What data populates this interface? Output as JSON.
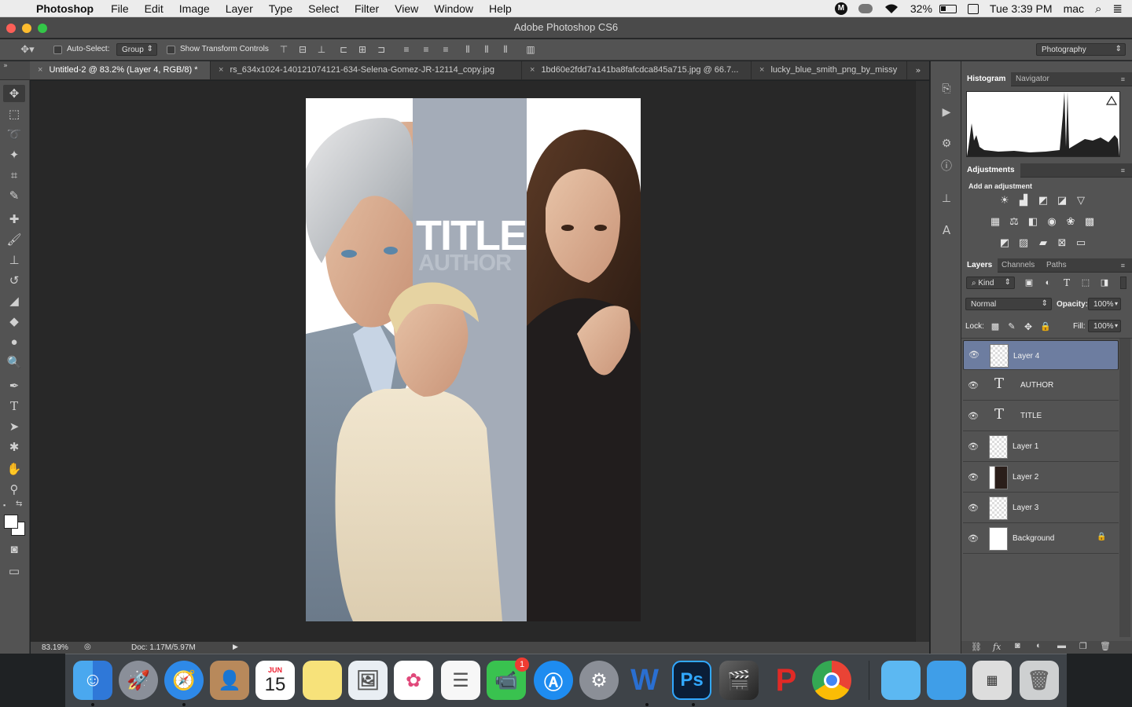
{
  "menubar": {
    "app": "Photoshop",
    "items": [
      "File",
      "Edit",
      "Image",
      "Layer",
      "Type",
      "Select",
      "Filter",
      "View",
      "Window",
      "Help"
    ],
    "battery": "32%",
    "clock": "Tue 3:39 PM",
    "user": "mac",
    "icons": [
      "apple-icon",
      "malwarebytes-icon",
      "creative-cloud-icon",
      "wifi-icon",
      "battery-icon",
      "calendar-icon",
      "search-icon",
      "list-icon"
    ]
  },
  "window": {
    "title": "Adobe Photoshop CS6"
  },
  "options": {
    "auto_select_label": "Auto-Select:",
    "auto_select_value": "Group",
    "transform_label": "Show Transform Controls",
    "workspace": "Photography"
  },
  "tabs": [
    {
      "label": "Untitled-2 @ 83.2% (Layer 4, RGB/8) *",
      "active": true
    },
    {
      "label": "rs_634x1024-140121074121-634-Selena-Gomez-JR-12114_copy.jpg",
      "active": false
    },
    {
      "label": "1bd60e2fdd7a141ba8fafcdca845a715.jpg @ 66.7...",
      "active": false
    },
    {
      "label": "lucky_blue_smith_png_by_missy",
      "active": false
    }
  ],
  "canvas": {
    "title_text": "TITLE",
    "author_text": "AUTHOR",
    "stripe_color": "#a4acb8"
  },
  "status": {
    "zoom": "83.19%",
    "doc": "Doc: 1.17M/5.97M"
  },
  "panels": {
    "histogram_tab": "Histogram",
    "navigator_tab": "Navigator",
    "adjustments_tab": "Adjustments",
    "add_adjustment": "Add an adjustment",
    "layers_tab": "Layers",
    "channels_tab": "Channels",
    "paths_tab": "Paths",
    "kind": "Kind",
    "blend_mode": "Normal",
    "opacity_label": "Opacity:",
    "opacity": "100%",
    "lock_label": "Lock:",
    "fill_label": "Fill:",
    "fill": "100%"
  },
  "layers": [
    {
      "name": "Layer 4",
      "type": "image",
      "selected": true
    },
    {
      "name": "AUTHOR",
      "type": "text",
      "selected": false
    },
    {
      "name": "TITLE",
      "type": "text",
      "selected": false
    },
    {
      "name": "Layer 1",
      "type": "image",
      "selected": false
    },
    {
      "name": "Layer 2",
      "type": "image",
      "selected": false
    },
    {
      "name": "Layer 3",
      "type": "image",
      "selected": false
    },
    {
      "name": "Background",
      "type": "background",
      "selected": false
    }
  ],
  "dock": {
    "calendar_month": "JUN",
    "calendar_day": "15",
    "facetime_badge": "1",
    "apps": [
      "Finder",
      "Launchpad",
      "Safari",
      "Contacts",
      "Calendar",
      "Notes",
      "Preview",
      "Photos",
      "Reminders",
      "FaceTime",
      "App Store",
      "System Preferences",
      "Word",
      "Photoshop",
      "Final Cut Pro",
      "WPS",
      "Chrome",
      "Folder",
      "Folder",
      "Downloads",
      "Trash"
    ]
  }
}
